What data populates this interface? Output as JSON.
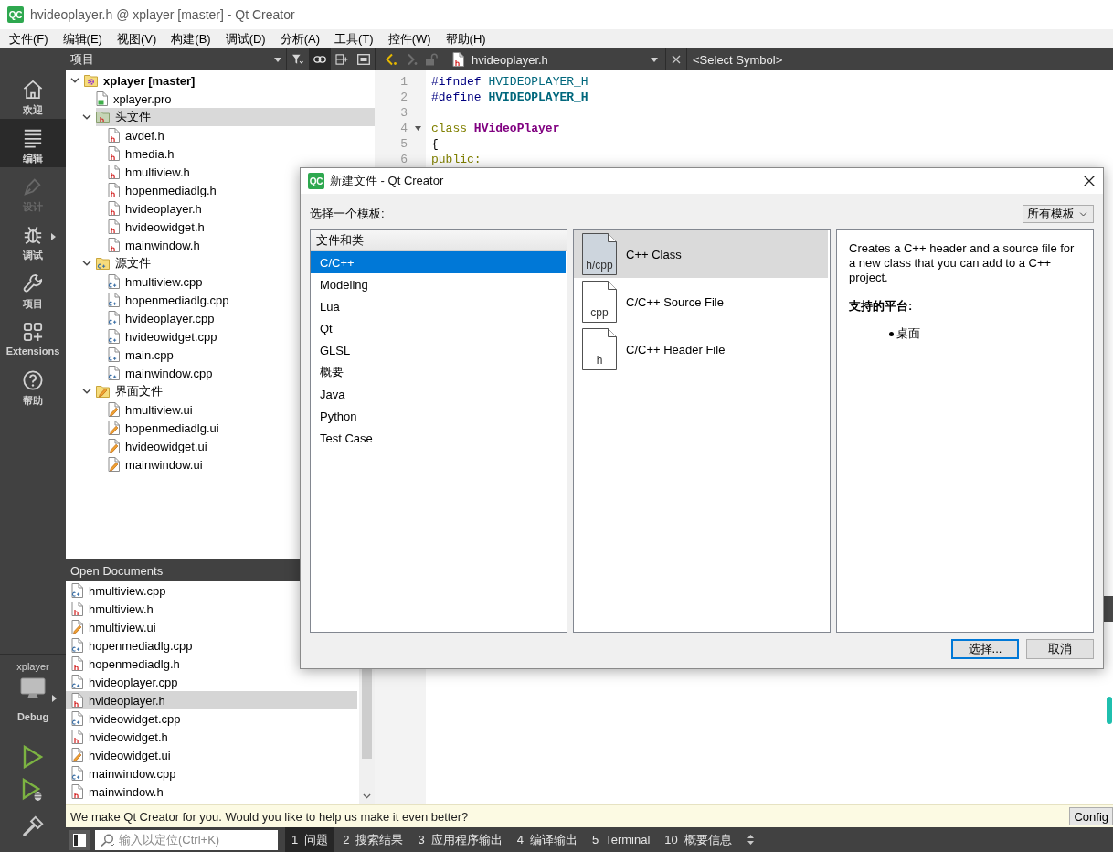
{
  "window": {
    "logo": "QC",
    "title": "hvideoplayer.h @ xplayer [master] - Qt Creator"
  },
  "menu_bar": [
    "文件(F)",
    "编辑(E)",
    "视图(V)",
    "构建(B)",
    "调试(D)",
    "分析(A)",
    "工具(T)",
    "控件(W)",
    "帮助(H)"
  ],
  "mode_bar": {
    "modes": [
      {
        "label": "欢迎",
        "kind": "welcome",
        "selected": false,
        "disabled": false,
        "has_menu": false
      },
      {
        "label": "编辑",
        "kind": "edit",
        "selected": true,
        "disabled": false,
        "has_menu": false
      },
      {
        "label": "设计",
        "kind": "design",
        "selected": false,
        "disabled": true,
        "has_menu": false
      },
      {
        "label": "调试",
        "kind": "debug",
        "selected": false,
        "disabled": false,
        "has_menu": true
      },
      {
        "label": "项目",
        "kind": "projects",
        "selected": false,
        "disabled": false,
        "has_menu": false
      },
      {
        "label": "Extensions",
        "kind": "extensions",
        "selected": false,
        "disabled": false,
        "has_menu": false
      },
      {
        "label": "帮助",
        "kind": "help",
        "selected": false,
        "disabled": false,
        "has_menu": false
      }
    ],
    "kit": {
      "project": "xplayer",
      "build": "Debug"
    },
    "actions": [
      {
        "kind": "run"
      },
      {
        "kind": "debug_run"
      },
      {
        "kind": "build"
      }
    ]
  },
  "project_panel": {
    "title": "项目",
    "tools": [
      {
        "kind": "filter",
        "on": false
      },
      {
        "kind": "link",
        "on": true
      },
      {
        "kind": "split",
        "on": false
      },
      {
        "kind": "panel",
        "on": false
      }
    ],
    "tree": [
      {
        "name": "xplayer [master]",
        "kind": "project",
        "selected": false,
        "expanded": true,
        "children": [
          {
            "name": "xplayer.pro",
            "kind": "pro",
            "selected": false
          },
          {
            "name": "头文件",
            "kind": "header_folder",
            "selected": true,
            "expanded": true,
            "children": [
              {
                "name": "avdef.h",
                "kind": "header",
                "selected": false
              },
              {
                "name": "hmedia.h",
                "kind": "header",
                "selected": false
              },
              {
                "name": "hmultiview.h",
                "kind": "header",
                "selected": false
              },
              {
                "name": "hopenmediadlg.h",
                "kind": "header",
                "selected": false
              },
              {
                "name": "hvideoplayer.h",
                "kind": "header",
                "selected": false
              },
              {
                "name": "hvideowidget.h",
                "kind": "header",
                "selected": false
              },
              {
                "name": "mainwindow.h",
                "kind": "header",
                "selected": false
              }
            ]
          },
          {
            "name": "源文件",
            "kind": "source_folder",
            "selected": false,
            "expanded": true,
            "children": [
              {
                "name": "hmultiview.cpp",
                "kind": "source",
                "selected": false
              },
              {
                "name": "hopenmediadlg.cpp",
                "kind": "source",
                "selected": false
              },
              {
                "name": "hvideoplayer.cpp",
                "kind": "source",
                "selected": false
              },
              {
                "name": "hvideowidget.cpp",
                "kind": "source",
                "selected": false
              },
              {
                "name": "main.cpp",
                "kind": "source",
                "selected": false
              },
              {
                "name": "mainwindow.cpp",
                "kind": "source",
                "selected": false
              }
            ]
          },
          {
            "name": "界面文件",
            "kind": "form_folder",
            "selected": false,
            "expanded": true,
            "children": [
              {
                "name": "hmultiview.ui",
                "kind": "form",
                "selected": false
              },
              {
                "name": "hopenmediadlg.ui",
                "kind": "form",
                "selected": false
              },
              {
                "name": "hvideowidget.ui",
                "kind": "form",
                "selected": false
              },
              {
                "name": "mainwindow.ui",
                "kind": "form",
                "selected": false
              }
            ]
          }
        ]
      }
    ]
  },
  "editor": {
    "toolbar": {
      "nav": [
        {
          "kind": "back",
          "disabled": false
        },
        {
          "kind": "forward",
          "disabled": true
        },
        {
          "kind": "lock",
          "disabled": true
        }
      ],
      "file": "hvideoplayer.h",
      "symbol": "<Select Symbol>"
    },
    "lines": [
      {
        "number": "1",
        "foldable": false,
        "tokens": [
          {
            "text": "#ifndef",
            "kind": "directive"
          },
          {
            "text": "HVIDEOPLAYER_H",
            "kind": "macro"
          }
        ]
      },
      {
        "number": "2",
        "foldable": false,
        "tokens": [
          {
            "text": "#define",
            "kind": "directive"
          },
          {
            "text": "HVIDEOPLAYER_H",
            "kind": "macro_def"
          }
        ]
      },
      {
        "number": "3",
        "foldable": false
      },
      {
        "number": "4",
        "foldable": true,
        "tokens": [
          {
            "text": "class",
            "kind": "keyword"
          },
          {
            "text": "HVideoPlayer",
            "kind": "type"
          }
        ]
      },
      {
        "number": "5",
        "foldable": false,
        "tokens": [
          {
            "text": "{",
            "kind": "plain"
          }
        ]
      },
      {
        "number": "6",
        "foldable": false,
        "tokens": [
          {
            "text": "public:",
            "kind": "keyword"
          }
        ]
      }
    ]
  },
  "open_documents": {
    "title": "Open Documents",
    "items": [
      {
        "name": "hmultiview.cpp",
        "kind": "source",
        "selected": false
      },
      {
        "name": "hmultiview.h",
        "kind": "header",
        "selected": false
      },
      {
        "name": "hmultiview.ui",
        "kind": "form",
        "selected": false
      },
      {
        "name": "hopenmediadlg.cpp",
        "kind": "source",
        "selected": false
      },
      {
        "name": "hopenmediadlg.h",
        "kind": "header",
        "selected": false
      },
      {
        "name": "hvideoplayer.cpp",
        "kind": "source",
        "selected": false
      },
      {
        "name": "hvideoplayer.h",
        "kind": "header",
        "selected": true
      },
      {
        "name": "hvideowidget.cpp",
        "kind": "source",
        "selected": false
      },
      {
        "name": "hvideowidget.h",
        "kind": "header",
        "selected": false
      },
      {
        "name": "hvideowidget.ui",
        "kind": "form",
        "selected": false
      },
      {
        "name": "mainwindow.cpp",
        "kind": "source",
        "selected": false
      },
      {
        "name": "mainwindow.h",
        "kind": "header",
        "selected": false
      }
    ]
  },
  "info_bar": {
    "message": "We make Qt Creator for you. Would you like to help us make it even better?",
    "button": "Config"
  },
  "status_bar": {
    "search": {
      "placeholder": "输入以定位(Ctrl+K)"
    },
    "tabs": [
      {
        "number": "1",
        "label": "问题",
        "selected": true
      },
      {
        "number": "2",
        "label": "搜索结果",
        "selected": false
      },
      {
        "number": "3",
        "label": "应用程序输出",
        "selected": false
      },
      {
        "number": "4",
        "label": "编译输出",
        "selected": false
      },
      {
        "number": "5",
        "label": "Terminal",
        "selected": false
      },
      {
        "number": "10",
        "label": "概要信息",
        "selected": false
      }
    ]
  },
  "dialog": {
    "logo": "QC",
    "title": "新建文件 - Qt Creator",
    "prompt": "选择一个模板:",
    "filter": "所有模板",
    "categories_header": "文件和类",
    "categories": [
      {
        "label": "C/C++",
        "selected": true
      },
      {
        "label": "Modeling",
        "selected": false
      },
      {
        "label": "Lua",
        "selected": false
      },
      {
        "label": "Qt",
        "selected": false
      },
      {
        "label": "GLSL",
        "selected": false
      },
      {
        "label": "概要",
        "selected": false
      },
      {
        "label": "Java",
        "selected": false
      },
      {
        "label": "Python",
        "selected": false
      },
      {
        "label": "Test Case",
        "selected": false
      }
    ],
    "templates": [
      {
        "label": "C++ Class",
        "icon_label": "h/cpp",
        "selected": true
      },
      {
        "label": "C/C++ Source File",
        "icon_label": "cpp",
        "selected": false
      },
      {
        "label": "C/C++ Header File",
        "icon_label": "h",
        "selected": false
      }
    ],
    "description": "Creates a C++ header and a source file for a new class that you can add to a C++ project.",
    "platforms_heading": "支持的平台:",
    "platforms": [
      "桌面"
    ],
    "buttons": [
      {
        "label": "选择...",
        "default": true
      },
      {
        "label": "取消",
        "default": false
      }
    ]
  }
}
